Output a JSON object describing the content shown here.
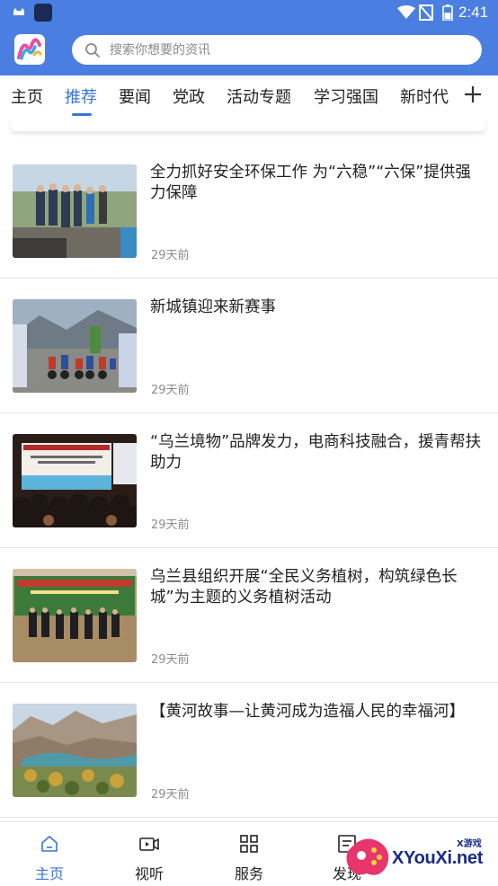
{
  "status_bar": {
    "time": "2:41"
  },
  "search": {
    "placeholder": "搜索你想要的资讯"
  },
  "tabs": [
    {
      "label": "主页"
    },
    {
      "label": "推荐",
      "active": true
    },
    {
      "label": "要闻"
    },
    {
      "label": "党政"
    },
    {
      "label": "活动专题"
    },
    {
      "label": "学习强国"
    },
    {
      "label": "新时代"
    }
  ],
  "news": [
    {
      "title": "全力抓好安全环保工作  为“六稳”“六保”提供强力保障",
      "time": "29天前"
    },
    {
      "title": "新城镇迎来新赛事",
      "time": "29天前"
    },
    {
      "title": "“乌兰境物”品牌发力，电商科技融合，援青帮扶助力",
      "time": "29天前"
    },
    {
      "title": "乌兰县组织开展“全民义务植树，构筑绿色长城”为主题的义务植树活动",
      "time": "29天前"
    },
    {
      "title": "【黄河故事—让黄河成为造福人民的幸福河】",
      "time": "29天前"
    }
  ],
  "bottom_nav": [
    {
      "label": "主页",
      "icon": "home-icon",
      "active": true
    },
    {
      "label": "视听",
      "icon": "video-icon"
    },
    {
      "label": "服务",
      "icon": "grid-icon"
    },
    {
      "label": "发现",
      "icon": "discover-icon"
    }
  ],
  "watermark": {
    "text": "XYouXi.net",
    "small": "X游戏"
  },
  "colors": {
    "brand": "#4a7fe1",
    "accent": "#3b73d9"
  }
}
